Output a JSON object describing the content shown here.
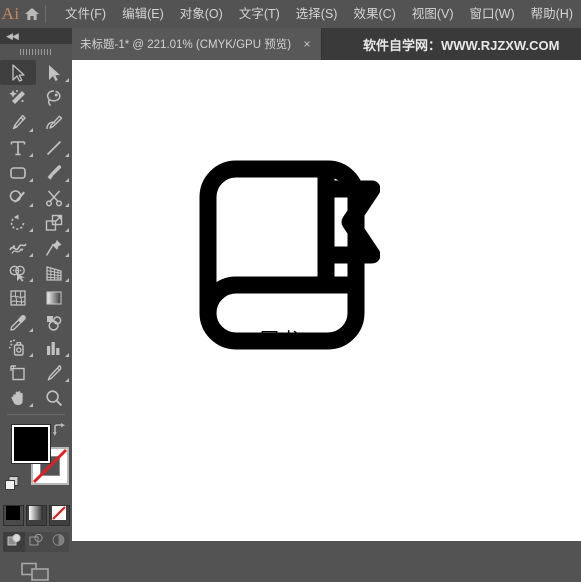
{
  "app": {
    "logo_text": "Ai",
    "logo_color": "#c88a5a",
    "home_icon": "home-icon"
  },
  "menubar": {
    "items": [
      {
        "label": "文件(F)",
        "name": "menu-file"
      },
      {
        "label": "编辑(E)",
        "name": "menu-edit"
      },
      {
        "label": "对象(O)",
        "name": "menu-object"
      },
      {
        "label": "文字(T)",
        "name": "menu-type"
      },
      {
        "label": "选择(S)",
        "name": "menu-select"
      },
      {
        "label": "效果(C)",
        "name": "menu-effect"
      },
      {
        "label": "视图(V)",
        "name": "menu-view"
      },
      {
        "label": "窗口(W)",
        "name": "menu-window"
      },
      {
        "label": "帮助(H)",
        "name": "menu-help"
      }
    ]
  },
  "tabbar": {
    "document_tab": {
      "title": "未标题-1* @ 221.01% (CMYK/GPU 预览)",
      "close_label": "×",
      "active": true
    },
    "watermark": "软件自学网：WWW.RJZXW.COM"
  },
  "toolpanel": {
    "collapse_label": "◀◀",
    "tools": [
      {
        "label": "选择工具",
        "icon": "selection-arrow-icon",
        "selected": true,
        "has_flyout": false
      },
      {
        "label": "直接选择工具",
        "icon": "direct-selection-arrow-icon",
        "selected": false,
        "has_flyout": true
      },
      {
        "label": "魔棒工具",
        "icon": "magic-wand-icon",
        "selected": false,
        "has_flyout": false
      },
      {
        "label": "套索工具",
        "icon": "lasso-icon",
        "selected": false,
        "has_flyout": false
      },
      {
        "label": "钢笔工具",
        "icon": "pen-icon",
        "selected": false,
        "has_flyout": true
      },
      {
        "label": "曲率工具",
        "icon": "curvature-icon",
        "selected": false,
        "has_flyout": false
      },
      {
        "label": "文字工具",
        "icon": "type-t-icon",
        "selected": false,
        "has_flyout": true
      },
      {
        "label": "直线段工具",
        "icon": "line-segment-icon",
        "selected": false,
        "has_flyout": true
      },
      {
        "label": "矩形工具",
        "icon": "rounded-rectangle-icon",
        "selected": false,
        "has_flyout": true
      },
      {
        "label": "画笔工具",
        "icon": "paintbrush-icon",
        "selected": false,
        "has_flyout": true
      },
      {
        "label": "Shaper 工具",
        "icon": "shaper-pencil-icon",
        "selected": false,
        "has_flyout": true
      },
      {
        "label": "剪刀工具",
        "icon": "scissors-icon",
        "selected": false,
        "has_flyout": true
      },
      {
        "label": "旋转工具",
        "icon": "rotate-icon",
        "selected": false,
        "has_flyout": true
      },
      {
        "label": "比例缩放工具",
        "icon": "scale-icon",
        "selected": false,
        "has_flyout": true
      },
      {
        "label": "宽度工具",
        "icon": "width-warp-icon",
        "selected": false,
        "has_flyout": true
      },
      {
        "label": "自由变换工具",
        "icon": "free-transform-pin-icon",
        "selected": false,
        "has_flyout": true
      },
      {
        "label": "形状生成器工具",
        "icon": "shape-builder-icon",
        "selected": false,
        "has_flyout": true
      },
      {
        "label": "透视网格工具",
        "icon": "perspective-grid-icon",
        "selected": false,
        "has_flyout": true
      },
      {
        "label": "网格工具",
        "icon": "mesh-icon",
        "selected": false,
        "has_flyout": false
      },
      {
        "label": "渐变工具",
        "icon": "gradient-icon",
        "selected": false,
        "has_flyout": false
      },
      {
        "label": "吸管工具",
        "icon": "eyedropper-icon",
        "selected": false,
        "has_flyout": true
      },
      {
        "label": "混合工具",
        "icon": "blend-icon",
        "selected": false,
        "has_flyout": false
      },
      {
        "label": "符号喷枪工具",
        "icon": "symbol-sprayer-icon",
        "selected": false,
        "has_flyout": true
      },
      {
        "label": "柱形图工具",
        "icon": "column-graph-icon",
        "selected": false,
        "has_flyout": true
      },
      {
        "label": "画板工具",
        "icon": "artboard-icon",
        "selected": false,
        "has_flyout": false
      },
      {
        "label": "切片工具",
        "icon": "slice-knife-icon",
        "selected": false,
        "has_flyout": true
      },
      {
        "label": "抓手工具",
        "icon": "hand-icon",
        "selected": false,
        "has_flyout": true
      },
      {
        "label": "缩放工具",
        "icon": "zoom-magnifier-icon",
        "selected": false,
        "has_flyout": false
      }
    ],
    "color": {
      "fill_label": "填色",
      "fill_color": "#000000",
      "stroke_label": "描边",
      "stroke_color": "#ffffff",
      "stroke_is_none": true,
      "swap_label": "互换填色和描边",
      "default_label": "默认填色和描边"
    },
    "paint_modes": [
      {
        "label": "颜色",
        "icon": "solid-color-icon",
        "active": true
      },
      {
        "label": "渐变",
        "icon": "gradient-swatch-icon",
        "active": false
      },
      {
        "label": "无",
        "icon": "none-swatch-icon",
        "active": false
      }
    ],
    "draw_modes": [
      {
        "label": "正常绘图",
        "icon": "draw-normal-icon",
        "active": true
      },
      {
        "label": "背面绘图",
        "icon": "draw-behind-icon",
        "active": false
      },
      {
        "label": "内部绘图",
        "icon": "draw-inside-icon",
        "active": false
      }
    ],
    "screen_mode": {
      "label": "更改屏幕模式",
      "icon": "screen-mode-icon"
    }
  },
  "canvas": {
    "background_color": "#ffffff",
    "artwork": {
      "name": "book-with-bookmark-icon",
      "label": "图书",
      "color": "#000000"
    }
  }
}
